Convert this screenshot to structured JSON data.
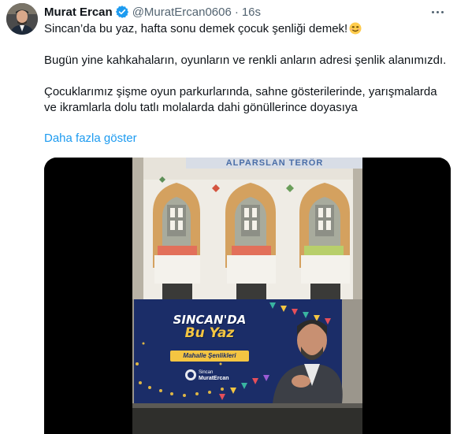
{
  "tweet": {
    "author_name": "Murat Ercan",
    "handle": "@MuratErcan0606",
    "separator": "·",
    "time": "16s",
    "verified_icon": "verified-badge-icon",
    "more_icon": "more-options-icon",
    "paragraphs": [
      "Sincan’da bu yaz, hafta sonu demek çocuk şenliği demek!",
      "Bugün yine kahkahaların, oyunların ve renkli anların adresi şenlik alanımızdı.",
      "Çocuklarımız şişme oyun parkurlarında, sahne gösterilerinde, yarışmalarda ve ikramlarla dolu tatlı molalarda dahi gönüllerince doyasıya"
    ],
    "emoji_icon": "smiling-face-emoji-icon",
    "show_more": "Daha fazla göster"
  },
  "media": {
    "building_sign": "ALPARSLAN TERÖR",
    "banner_line1": "SINCAN'DA",
    "banner_line2": "Bu Yaz",
    "banner_sub": "Mahalle Şenlikleri",
    "banner_brand_small": "Sincan",
    "banner_brand_name": "MuratErcan",
    "colors": {
      "banner": "#1b2d68",
      "accent": "#f4c542",
      "link": "#1d9bf0"
    }
  }
}
